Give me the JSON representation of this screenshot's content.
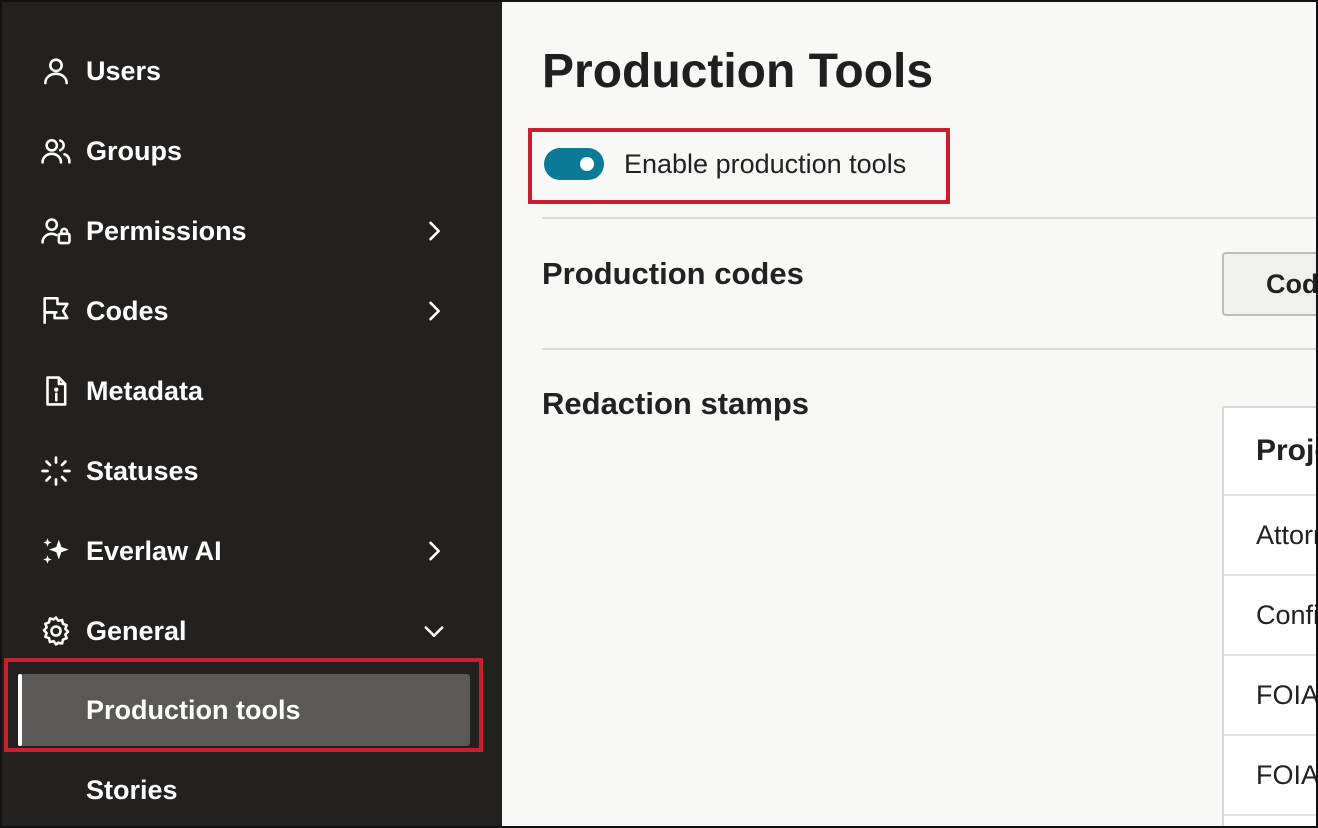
{
  "sidebar": {
    "items": [
      {
        "label": "Users",
        "icon": "user-icon",
        "chevron": "none"
      },
      {
        "label": "Groups",
        "icon": "groups-icon",
        "chevron": "none"
      },
      {
        "label": "Permissions",
        "icon": "user-lock-icon",
        "chevron": "right"
      },
      {
        "label": "Codes",
        "icon": "flag-icon",
        "chevron": "right"
      },
      {
        "label": "Metadata",
        "icon": "file-info-icon",
        "chevron": "none"
      },
      {
        "label": "Statuses",
        "icon": "loader-icon",
        "chevron": "none"
      },
      {
        "label": "Everlaw AI",
        "icon": "sparkles-icon",
        "chevron": "right"
      },
      {
        "label": "General",
        "icon": "gear-icon",
        "chevron": "down"
      }
    ],
    "sub_items": [
      {
        "label": "Production tools",
        "active": true
      },
      {
        "label": "Stories",
        "active": false
      }
    ]
  },
  "main": {
    "title": "Production Tools",
    "toggle": {
      "label": "Enable production tools",
      "enabled": true
    },
    "sections": {
      "codes_title": "Production codes",
      "codes_button": "Codes",
      "stamps_title": "Redaction stamps"
    },
    "stamps_table": {
      "header": "Project",
      "rows": [
        "Attorney",
        "Confidential",
        "FOIA",
        "FOIA"
      ]
    }
  },
  "colors": {
    "sidebar_bg": "#23211f",
    "active_item_bg": "#5b5955",
    "toggle_on": "#0b7a96",
    "highlight": "#c8202f"
  }
}
